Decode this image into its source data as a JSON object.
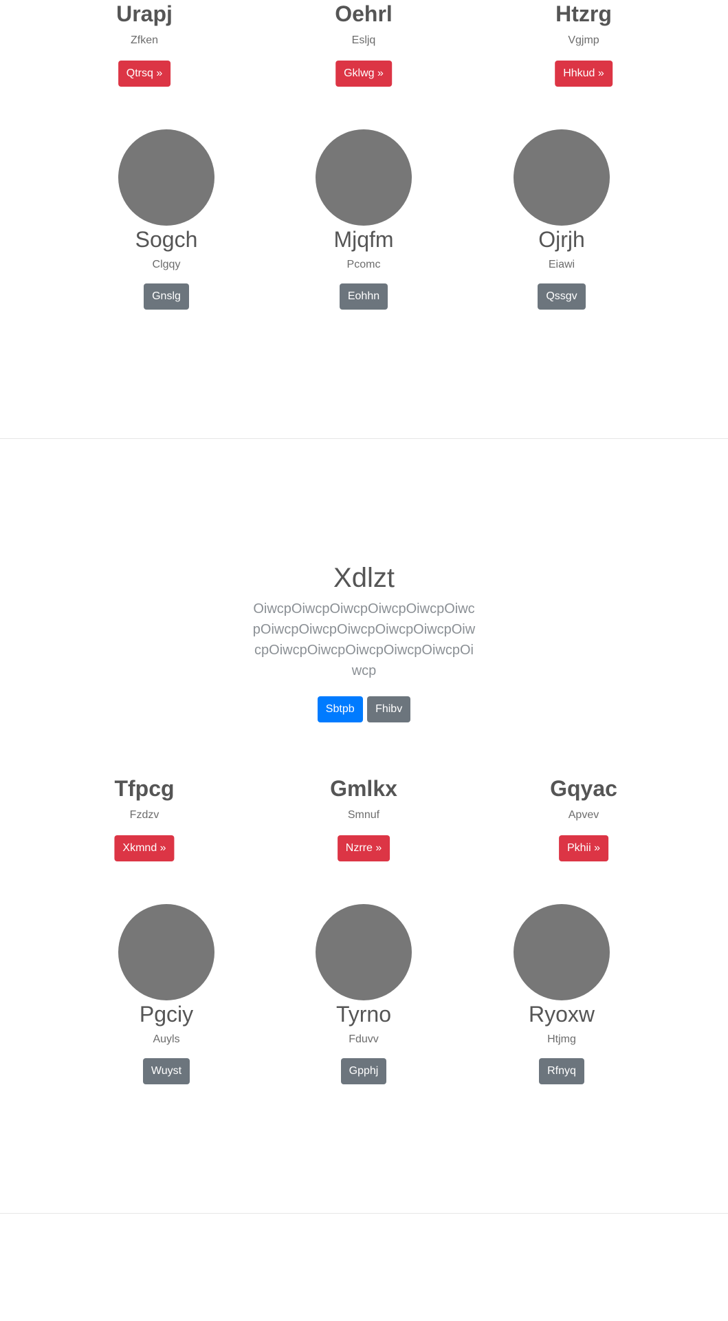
{
  "block1": {
    "features": [
      {
        "title": "Urapj",
        "subtitle": "Zfken",
        "button": "Qtrsq »"
      },
      {
        "title": "Oehrl",
        "subtitle": "Esljq",
        "button": "Gklwg »"
      },
      {
        "title": "Htzrg",
        "subtitle": "Vgjmp",
        "button": "Hhkud »"
      }
    ],
    "people": [
      {
        "name": "Sogch",
        "subtitle": "Clgqy",
        "button": "Gnslg"
      },
      {
        "name": "Mjqfm",
        "subtitle": "Pcomc",
        "button": "Eohhn"
      },
      {
        "name": "Ojrjh",
        "subtitle": "Eiawi",
        "button": "Qssgv"
      }
    ]
  },
  "hero": {
    "title": "Xdlzt",
    "lead": "OiwcpOiwcpOiwcpOiwcpOiwcpOiwcpOiwcpOiwcpOiwcpOiwcpOiwcpOiwcpOiwcpOiwcpOiwcpOiwcpOiwcpOiwcp",
    "primary_button": "Sbtpb",
    "secondary_button": "Fhibv"
  },
  "block2": {
    "features": [
      {
        "title": "Tfpcg",
        "subtitle": "Fzdzv",
        "button": "Xkmnd »"
      },
      {
        "title": "Gmlkx",
        "subtitle": "Smnuf",
        "button": "Nzrre »"
      },
      {
        "title": "Gqyac",
        "subtitle": "Apvev",
        "button": "Pkhii »"
      }
    ],
    "people": [
      {
        "name": "Pgciy",
        "subtitle": "Auyls",
        "button": "Wuyst"
      },
      {
        "name": "Tyrno",
        "subtitle": "Fduvv",
        "button": "Gpphj"
      },
      {
        "name": "Ryoxw",
        "subtitle": "Htjmg",
        "button": "Rfnyq"
      }
    ]
  },
  "colors": {
    "danger": "#dc3545",
    "secondary": "#6c757d",
    "primary": "#007bff",
    "avatar": "#777777"
  }
}
